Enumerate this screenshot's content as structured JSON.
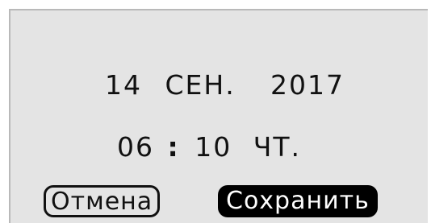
{
  "date": {
    "day": "14",
    "month": "СЕН.",
    "year": "2017"
  },
  "time": {
    "hours": "06",
    "separator": ":",
    "minutes": "10",
    "weekday": "ЧТ."
  },
  "buttons": {
    "cancel_label": "Отмена",
    "save_label": "Сохранить"
  }
}
